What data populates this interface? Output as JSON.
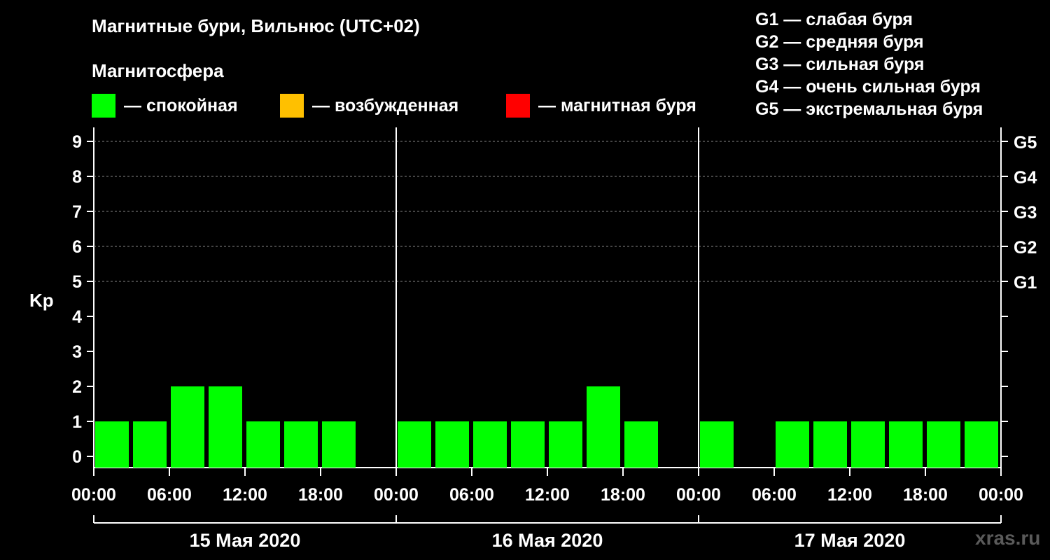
{
  "title": "Магнитные бури, Вильнюс (UTC+02)",
  "subtitle": "Магнитосфера",
  "legend": [
    {
      "label": "— спокойная",
      "color": "#00ff00"
    },
    {
      "label": "— возбужденная",
      "color": "#ffc000"
    },
    {
      "label": "— магнитная буря",
      "color": "#ff0000"
    }
  ],
  "g_legend": [
    "G1 — слабая буря",
    "G2 — средняя буря",
    "G3 — сильная буря",
    "G4 — очень сильная буря",
    "G5 — экстремальная буря"
  ],
  "watermark": "xras.ru",
  "chart_data": {
    "type": "bar",
    "ylabel": "Kp",
    "ylim": [
      0,
      9
    ],
    "y_ticks": [
      "0",
      "1",
      "2",
      "3",
      "4",
      "5",
      "6",
      "7",
      "8",
      "9"
    ],
    "right_ticks": [
      {
        "value": 5,
        "label": "G1"
      },
      {
        "value": 6,
        "label": "G2"
      },
      {
        "value": 7,
        "label": "G3"
      },
      {
        "value": 8,
        "label": "G4"
      },
      {
        "value": 9,
        "label": "G5"
      }
    ],
    "x_tick_labels": [
      "00:00",
      "06:00",
      "12:00",
      "18:00",
      "00:00",
      "06:00",
      "12:00",
      "18:00",
      "00:00",
      "06:00",
      "12:00",
      "18:00",
      "00:00"
    ],
    "days": [
      "15 Мая 2020",
      "16 Мая 2020",
      "17 Мая 2020"
    ],
    "interval_hours": 3,
    "grid": "dashed, y",
    "colors": {
      "quiet": "#00ff00",
      "active": "#ffc000",
      "storm": "#ff0000"
    },
    "values": [
      1,
      1,
      2,
      2,
      1,
      1,
      1,
      null,
      1,
      1,
      1,
      1,
      1,
      2,
      1,
      null,
      1,
      null,
      1,
      1,
      1,
      1,
      1,
      1
    ]
  }
}
